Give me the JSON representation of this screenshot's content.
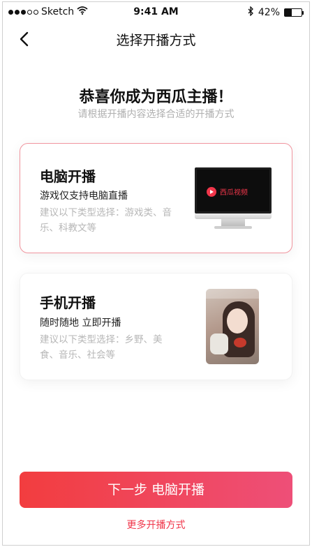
{
  "status_bar": {
    "carrier": "Sketch",
    "time": "9:41 AM",
    "battery_percent": "42%",
    "battery_level": 0.42
  },
  "nav": {
    "title": "选择开播方式",
    "back_icon": "chevron-left-icon"
  },
  "header": {
    "headline": "恭喜你成为西瓜主播！",
    "subtitle": "请根据开播内容选择合适的开播方式"
  },
  "options": [
    {
      "title": "电脑开播",
      "description": "游戏仅支持电脑直播",
      "hint": "建议以下类型选择：游戏类、音乐、科教文等",
      "image_text": "西瓜视频",
      "selected": true
    },
    {
      "title": "手机开播",
      "description": "随时随地 立即开播",
      "hint": "建议以下类型选择：乡野、美食、音乐、社会等",
      "selected": false
    }
  ],
  "actions": {
    "primary_label": "下一步 电脑开播",
    "secondary_label": "更多开播方式"
  },
  "colors": {
    "accent": "#f0364a",
    "gradient_start": "#f23d3f",
    "gradient_end": "#ee4f78",
    "selected_border": "#f0949e"
  }
}
